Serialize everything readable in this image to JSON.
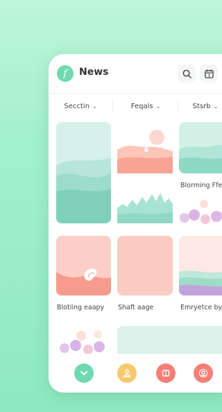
{
  "header": {
    "logo_letter": "f",
    "title": "News",
    "icons": [
      "search-icon",
      "calendar-icon"
    ]
  },
  "filters": [
    {
      "label": "Secctin"
    },
    {
      "label": "Feqals"
    },
    {
      "label": "Stsrb"
    }
  ],
  "cards": {
    "c1": {
      "caption": ""
    },
    "c2": {
      "caption": ""
    },
    "c3": {
      "caption": "Blorming Ffea"
    },
    "c4": {
      "caption": "Blotiing eaapy"
    },
    "c5": {
      "caption": "Shaft aage"
    },
    "c6": {
      "caption": "Emryetce by"
    }
  },
  "bottom_nav": [
    {
      "icon": "chevron-down-icon",
      "color": "#6fd9b1"
    },
    {
      "icon": "person-icon",
      "color": "#f7c96b"
    },
    {
      "icon": "bookmark-icon",
      "color": "#f47f76"
    },
    {
      "icon": "profile-icon",
      "color": "#f47f76"
    }
  ],
  "colors": {
    "accent": "#6fd9b1",
    "mint_tile": "#cfeee6",
    "peach_tile": "#fbd0c8",
    "coral": "#f5968a",
    "lavender": "#c9a6df"
  }
}
